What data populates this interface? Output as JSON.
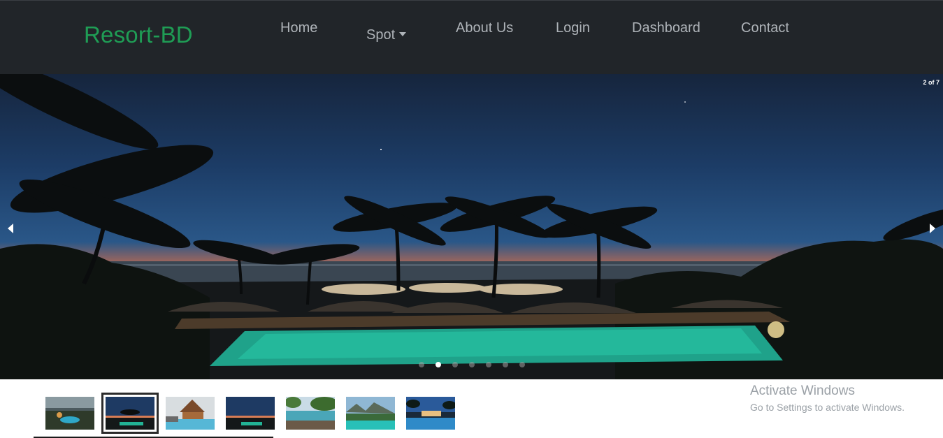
{
  "navbar": {
    "brand": "Resort-BD",
    "links": [
      "Home",
      "Spot",
      "About Us",
      "Login",
      "Dashboard",
      "Contact"
    ]
  },
  "carousel": {
    "counter": "2 of 7",
    "current_slide": 2,
    "total_slides": 7,
    "slide_description_icon": "resort-pool-at-dusk-photo"
  },
  "thumbnails": {
    "count": 7,
    "active_index": 1
  },
  "watermark": {
    "title": "Activate Windows",
    "subtitle": "Go to Settings to activate Windows."
  },
  "colors": {
    "navbar_bg": "#212529",
    "brand": "#1f9d55",
    "nav_text": "#aeb3b8"
  }
}
